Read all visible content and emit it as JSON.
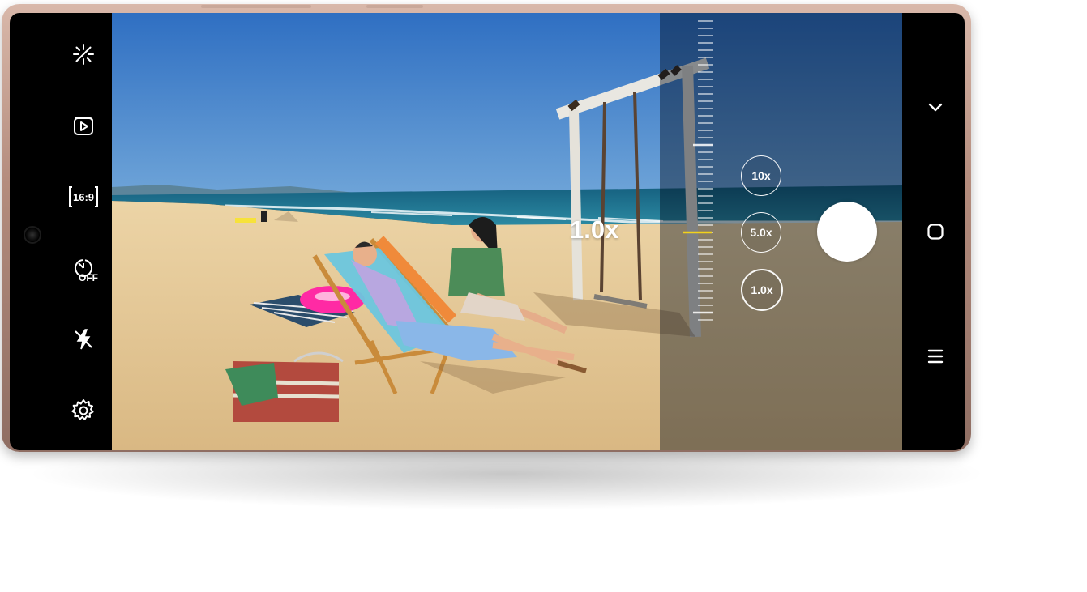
{
  "toolbar_left": {
    "items": [
      {
        "name": "effects-sparkle-icon"
      },
      {
        "name": "motion-photo-icon"
      },
      {
        "name": "aspect-ratio-icon",
        "label": "16:9"
      },
      {
        "name": "timer-icon",
        "label": "OFF"
      },
      {
        "name": "flash-off-icon"
      },
      {
        "name": "settings-gear-icon"
      }
    ]
  },
  "viewfinder": {
    "zoom_level": "1.0x",
    "zoom_buttons": [
      {
        "label": "10x",
        "active": false
      },
      {
        "label": "5.0x",
        "active": false
      },
      {
        "label": "1.0x",
        "active": true
      }
    ],
    "zoom_indicator_color": "#f2d21b"
  },
  "nav_right": {
    "items": [
      {
        "name": "chevron-down-icon"
      },
      {
        "name": "home-icon"
      },
      {
        "name": "menu-icon"
      }
    ]
  },
  "colors": {
    "phone_frame": "#b48c7d",
    "sky": "#3f80c8",
    "sand": "#e2c79a",
    "sea": "#1d6f8c"
  }
}
